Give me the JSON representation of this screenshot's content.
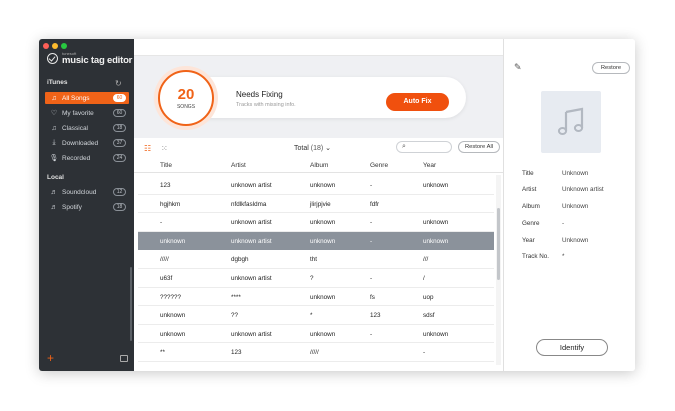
{
  "app": {
    "logo_small": "tunesoft",
    "logo_big": "music tag editor"
  },
  "sidebar": {
    "itunes_label": "iTunes",
    "local_label": "Local",
    "itunes_items": [
      {
        "label": "All Songs",
        "count": "60",
        "icon": "music-note-icon",
        "active": true
      },
      {
        "label": "My favorite",
        "count": "60",
        "icon": "heart-icon"
      },
      {
        "label": "Classical",
        "count": "18",
        "icon": "music-note-icon"
      },
      {
        "label": "Downloaded",
        "count": "37",
        "icon": "download-icon"
      },
      {
        "label": "Recorded",
        "count": "24",
        "icon": "microphone-icon"
      }
    ],
    "local_items": [
      {
        "label": "Soundcloud",
        "count": "12",
        "icon": "playlist-icon"
      },
      {
        "label": "Spotify",
        "count": "18",
        "icon": "playlist-icon"
      }
    ],
    "add_glyph": "+"
  },
  "banner": {
    "count": "20",
    "count_label": "SONGS",
    "title": "Needs Fixing",
    "subtitle": "Tracks with missing info.",
    "autofix_label": "Auto Fix"
  },
  "toolbar": {
    "total_label": "Total",
    "total_count": "(18)",
    "restore_all_label": "Restore All"
  },
  "table": {
    "headers": [
      "Title",
      "Artist",
      "Album",
      "Genre",
      "Year"
    ],
    "rows": [
      [
        "123",
        "unknown artist",
        "unknown",
        "-",
        "unknown"
      ],
      [
        "hgjhkm",
        "nfdlkfasldma",
        "jlirjpjvie",
        "fdfr",
        ""
      ],
      [
        "-",
        "unknown artist",
        "unknown",
        "-",
        "unknown"
      ],
      [
        "unknown",
        "unknown artist",
        "unknown",
        "-",
        "unknown"
      ],
      [
        "/////",
        "dgbgh",
        "tht",
        "",
        "///"
      ],
      [
        "u63f",
        "unknown artist",
        "?",
        "-",
        "/"
      ],
      [
        "??????",
        "****",
        "unknown",
        "fs",
        "uop"
      ],
      [
        "unknown",
        "??",
        "*",
        "123",
        "sdsf"
      ],
      [
        "unknown",
        "unknown artist",
        "unknown",
        "-",
        "unknown"
      ],
      [
        "**",
        "123",
        "/////",
        "",
        "-"
      ]
    ],
    "selected_row": 3
  },
  "detail": {
    "restore_label": "Restore",
    "identify_label": "Identify",
    "fields": [
      {
        "label": "Title",
        "value": "Unknown"
      },
      {
        "label": "Artist",
        "value": "Unknown artist"
      },
      {
        "label": "Album",
        "value": "Unknown"
      },
      {
        "label": "Genre",
        "value": "-"
      },
      {
        "label": "Year",
        "value": "Unknown"
      },
      {
        "label": "Track No.",
        "value": "*"
      }
    ]
  },
  "colors": {
    "accent": "#f06318",
    "sidebar_bg": "#2d3136",
    "selected_row": "#8b929b"
  }
}
